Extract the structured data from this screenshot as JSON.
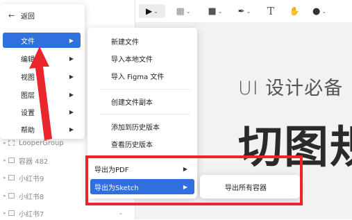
{
  "toolbar": {
    "tools": [
      {
        "name": "pointer-tool",
        "glyph": "▶"
      },
      {
        "name": "frame-tool",
        "glyph": "▦"
      },
      {
        "name": "shape-tool",
        "glyph": "■"
      },
      {
        "name": "pen-tool",
        "glyph": "✒"
      },
      {
        "name": "text-tool",
        "glyph": "T"
      },
      {
        "name": "hand-tool",
        "glyph": "✋"
      },
      {
        "name": "comment-tool",
        "glyph": "●"
      }
    ]
  },
  "canvas": {
    "title": "UI 设计必备",
    "big_text": "切图规"
  },
  "layers": [
    {
      "label": "LooperGroup"
    },
    {
      "label": "容器 482"
    },
    {
      "label": "小红书9"
    },
    {
      "label": "小红书8"
    },
    {
      "label": "小红书7"
    }
  ],
  "main_menu": {
    "back": "返回",
    "items": [
      {
        "label": "文件"
      },
      {
        "label": "编辑"
      },
      {
        "label": "视图"
      },
      {
        "label": "图层"
      },
      {
        "label": "设置"
      },
      {
        "label": "帮助"
      }
    ]
  },
  "file_menu": {
    "items": [
      {
        "label": "新建文件"
      },
      {
        "label": "导入本地文件"
      },
      {
        "label": "导入 Figma 文件"
      },
      {
        "label": "创建文件副本"
      },
      {
        "label": "添加到历史版本"
      },
      {
        "label": "查看历史版本"
      },
      {
        "label": "导出为PDF"
      },
      {
        "label": "导出为Sketch"
      }
    ]
  },
  "sketch_menu": {
    "items": [
      {
        "label": "导出所有容器"
      }
    ]
  },
  "colors": {
    "highlight": "#2f6fde",
    "annotation": "#e8262b"
  }
}
